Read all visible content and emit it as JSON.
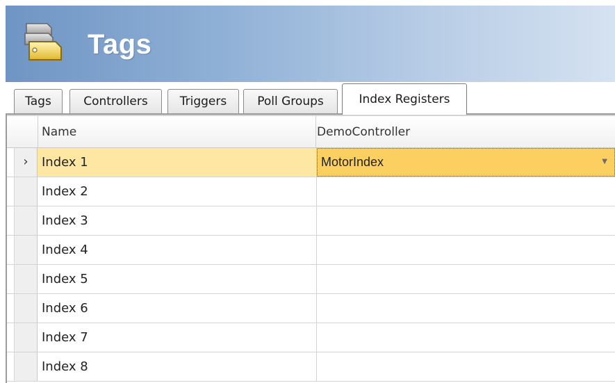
{
  "header": {
    "title": "Tags",
    "icon": "tags-stack-icon"
  },
  "tabs": [
    {
      "label": "Tags",
      "active": false
    },
    {
      "label": "Controllers",
      "active": false
    },
    {
      "label": "Triggers",
      "active": false
    },
    {
      "label": "Poll Groups",
      "active": false
    },
    {
      "label": "Index Registers",
      "active": true
    }
  ],
  "grid": {
    "columns": [
      "Name",
      "DemoController"
    ],
    "selected_row": 0,
    "rows": [
      {
        "name": "Index 1",
        "controller": "MotorIndex"
      },
      {
        "name": "Index 2",
        "controller": ""
      },
      {
        "name": "Index 3",
        "controller": ""
      },
      {
        "name": "Index 4",
        "controller": ""
      },
      {
        "name": "Index 5",
        "controller": ""
      },
      {
        "name": "Index 6",
        "controller": ""
      },
      {
        "name": "Index 7",
        "controller": ""
      },
      {
        "name": "Index 8",
        "controller": ""
      }
    ],
    "current_row_glyph": "›",
    "dropdown_glyph": "▼"
  },
  "colors": {
    "header_gradient_start": "#6f95c4",
    "header_gradient_end": "#d5e2f1",
    "selected_row": "#fde7a3",
    "selected_cell": "#fbd060"
  }
}
